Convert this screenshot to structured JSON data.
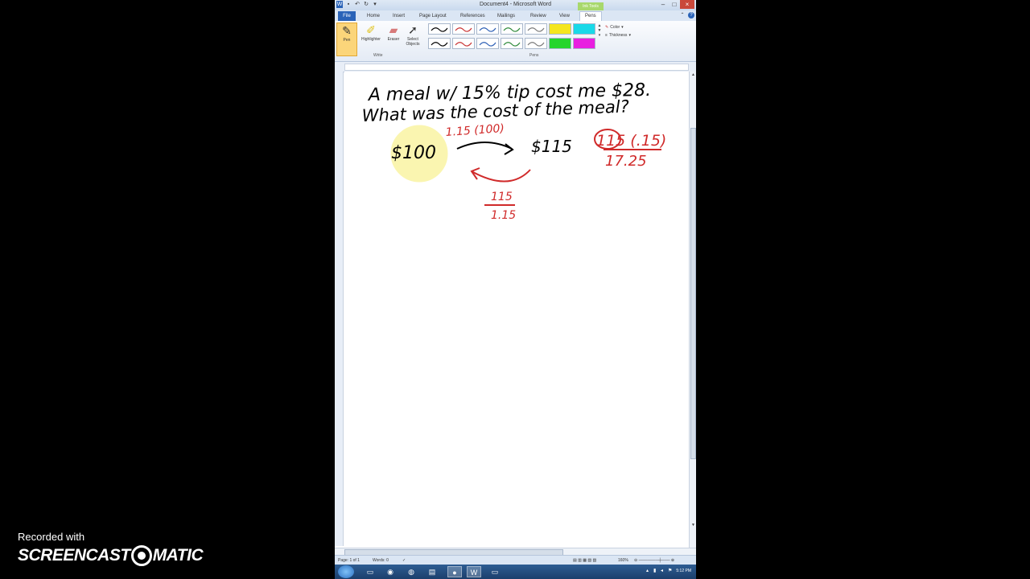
{
  "window": {
    "title": "Document4 - Microsoft Word",
    "context_tab": "Ink Tools"
  },
  "tabs": [
    "File",
    "Home",
    "Insert",
    "Page Layout",
    "References",
    "Mailings",
    "Review",
    "View",
    "Pens"
  ],
  "ribbon": {
    "write_tools": [
      {
        "label": "Pen",
        "icon": "pen-icon",
        "selected": true
      },
      {
        "label": "Highlighter",
        "icon": "highlighter-icon"
      },
      {
        "label": "Eraser",
        "icon": "eraser-icon"
      },
      {
        "label": "Select Objects",
        "icon": "select-arrow-icon"
      }
    ],
    "write_group_label": "Write",
    "pens_group_label": "Pens",
    "pen_swatches": [
      {
        "color": "#000000",
        "kind": "pen"
      },
      {
        "color": "#c83232",
        "kind": "pen"
      },
      {
        "color": "#2c5fb5",
        "kind": "pen"
      },
      {
        "color": "#2f8a3b",
        "kind": "pen"
      },
      {
        "color": "#7a7a7a",
        "kind": "pen"
      },
      {
        "color": "#f5e61f",
        "kind": "highlighter"
      },
      {
        "color": "#19d9e8",
        "kind": "highlighter"
      },
      {
        "color": "#000000",
        "kind": "pen"
      },
      {
        "color": "#c83232",
        "kind": "pen"
      },
      {
        "color": "#2c5fb5",
        "kind": "pen"
      },
      {
        "color": "#2f8a3b",
        "kind": "pen"
      },
      {
        "color": "#7a7a7a",
        "kind": "pen"
      },
      {
        "color": "#25d52c",
        "kind": "highlighter"
      },
      {
        "color": "#e81fe0",
        "kind": "highlighter"
      }
    ],
    "color_label": "Color",
    "thickness_label": "Thickness"
  },
  "ink_text": {
    "line1": "A meal w/ 15% tip cost me $28.",
    "line2": "What was the cost of the meal?",
    "left_value": "$100",
    "right_value": "$115",
    "mult_label": "1.15 (100)",
    "div_num": "115",
    "div_den": "1.15",
    "side_calc": "115 (.15)",
    "side_result": "17.25"
  },
  "status": {
    "page": "Page: 1 of 1",
    "words": "Words: 0",
    "zoom": "160%"
  },
  "taskbar": {
    "clock": "5:12 PM"
  },
  "watermark": {
    "top": "Recorded with",
    "brand_left": "SCREENCAST",
    "brand_right": "MATIC"
  },
  "colors": {
    "ink_black": "#000000",
    "ink_red": "#d02a2a",
    "highlight_yellow": "#f2e421",
    "file_tab_blue": "#2a63b8"
  }
}
